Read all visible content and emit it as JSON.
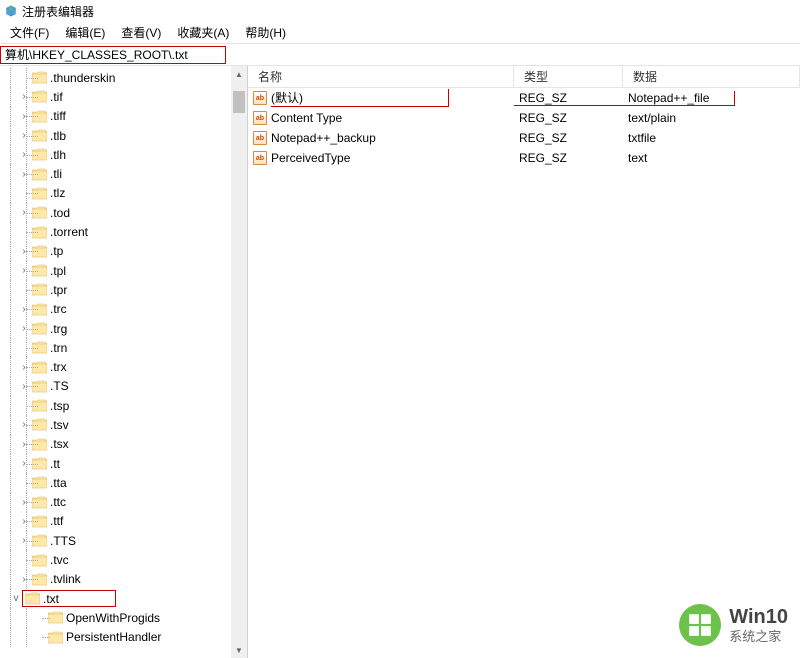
{
  "title": "注册表编辑器",
  "menu": {
    "file": "文件(F)",
    "edit": "编辑(E)",
    "view": "查看(V)",
    "favorites": "收藏夹(A)",
    "help": "帮助(H)"
  },
  "address": "算机\\HKEY_CLASSES_ROOT\\.txt",
  "tree": {
    "items": [
      {
        "label": ".thunderskin",
        "exp": ""
      },
      {
        "label": ".tif",
        "exp": "›"
      },
      {
        "label": ".tiff",
        "exp": "›"
      },
      {
        "label": ".tlb",
        "exp": "›"
      },
      {
        "label": ".tlh",
        "exp": "›"
      },
      {
        "label": ".tli",
        "exp": "›"
      },
      {
        "label": ".tlz",
        "exp": ""
      },
      {
        "label": ".tod",
        "exp": "›"
      },
      {
        "label": ".torrent",
        "exp": ""
      },
      {
        "label": ".tp",
        "exp": "›"
      },
      {
        "label": ".tpl",
        "exp": "›"
      },
      {
        "label": ".tpr",
        "exp": ""
      },
      {
        "label": ".trc",
        "exp": "›"
      },
      {
        "label": ".trg",
        "exp": "›"
      },
      {
        "label": ".trn",
        "exp": ""
      },
      {
        "label": ".trx",
        "exp": "›"
      },
      {
        "label": ".TS",
        "exp": "›"
      },
      {
        "label": ".tsp",
        "exp": ""
      },
      {
        "label": ".tsv",
        "exp": "›"
      },
      {
        "label": ".tsx",
        "exp": "›"
      },
      {
        "label": ".tt",
        "exp": "›"
      },
      {
        "label": ".tta",
        "exp": ""
      },
      {
        "label": ".ttc",
        "exp": "›"
      },
      {
        "label": ".ttf",
        "exp": "›"
      },
      {
        "label": ".TTS",
        "exp": "›"
      },
      {
        "label": ".tvc",
        "exp": ""
      },
      {
        "label": ".tvlink",
        "exp": "›"
      },
      {
        "label": ".txt",
        "exp": "v",
        "selected": true
      }
    ],
    "children": [
      {
        "label": "OpenWithProgids"
      },
      {
        "label": "PersistentHandler"
      }
    ]
  },
  "list": {
    "headers": {
      "name": "名称",
      "type": "类型",
      "data": "数据"
    },
    "rows": [
      {
        "name": "(默认)",
        "type": "REG_SZ",
        "data": "Notepad++_file",
        "highlighted": true
      },
      {
        "name": "Content Type",
        "type": "REG_SZ",
        "data": "text/plain"
      },
      {
        "name": "Notepad++_backup",
        "type": "REG_SZ",
        "data": "txtfile"
      },
      {
        "name": "PerceivedType",
        "type": "REG_SZ",
        "data": "text"
      }
    ]
  },
  "watermark": {
    "big": "Win10",
    "small": "系统之家"
  }
}
